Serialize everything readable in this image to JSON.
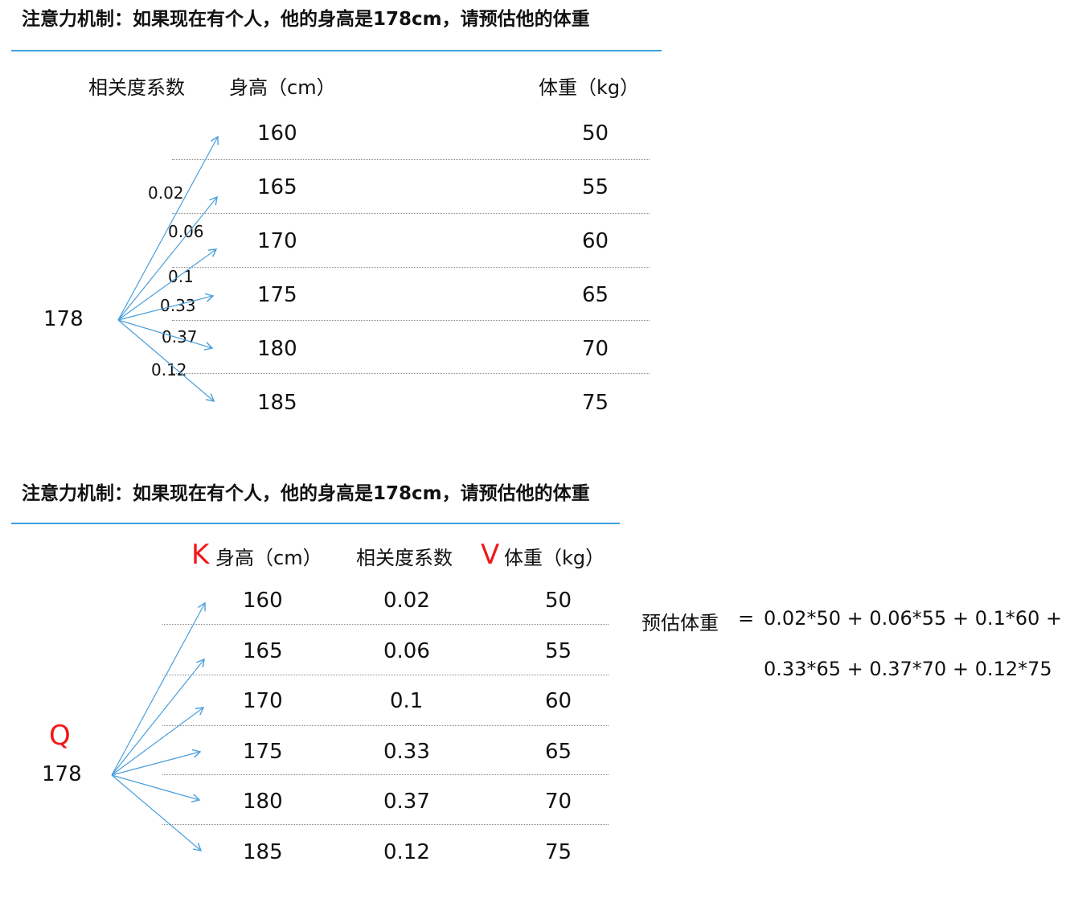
{
  "top": {
    "title": "注意力机制：如果现在有个人，他的身高是178cm，请预估他的体重",
    "headers": {
      "coef": "相关度系数",
      "height": "身高（cm）",
      "weight": "体重（kg）"
    },
    "query": "178",
    "rows": [
      {
        "height": "160",
        "weight": "50"
      },
      {
        "height": "165",
        "weight": "55"
      },
      {
        "height": "170",
        "weight": "60"
      },
      {
        "height": "175",
        "weight": "65"
      },
      {
        "height": "180",
        "weight": "70"
      },
      {
        "height": "185",
        "weight": "75"
      }
    ],
    "coefs": [
      "0.02",
      "0.06",
      "0.1",
      "0.33",
      "0.37",
      "0.12"
    ]
  },
  "bottom": {
    "title": "注意力机制：如果现在有个人，他的身高是178cm，请预估他的体重",
    "k_letter": "K",
    "v_letter": "V",
    "q_letter": "Q",
    "headers": {
      "height": "身高（cm）",
      "coef": "相关度系数",
      "weight": "体重（kg）"
    },
    "query": "178",
    "rows": [
      {
        "height": "160",
        "coef": "0.02",
        "weight": "50"
      },
      {
        "height": "165",
        "coef": "0.06",
        "weight": "55"
      },
      {
        "height": "170",
        "coef": "0.1",
        "weight": "60"
      },
      {
        "height": "175",
        "coef": "0.33",
        "weight": "65"
      },
      {
        "height": "180",
        "coef": "0.37",
        "weight": "70"
      },
      {
        "height": "185",
        "coef": "0.12",
        "weight": "75"
      }
    ],
    "formula": {
      "label": "预估体重",
      "eq": "=",
      "line1": "0.02*50 + 0.06*55 + 0.1*60 +",
      "line2": "0.33*65 + 0.37*70 + 0.12*75"
    }
  },
  "colors": {
    "rule": "#3fa0e0",
    "arrow": "#4a9fdc",
    "accent": "#f01818"
  }
}
